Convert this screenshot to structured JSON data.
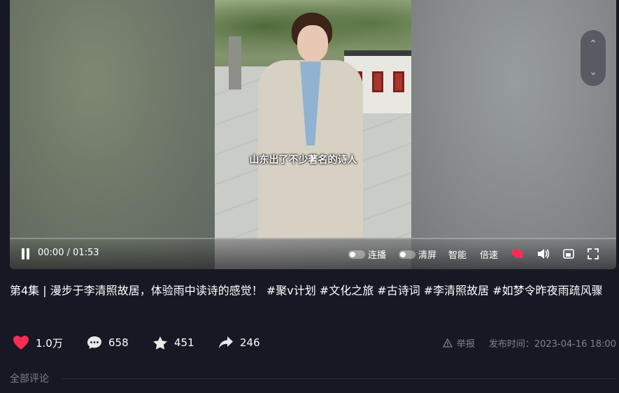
{
  "video": {
    "subtitle": "山东出了不少著名的诗人"
  },
  "player_controls": {
    "time_current": "00:00",
    "time_separator": "/",
    "time_total": "01:53",
    "autoplay_label": "连播",
    "clear_screen_label": "清屏",
    "smart_label": "智能",
    "speed_label": "倍速",
    "progress": 0
  },
  "post": {
    "title": "第4集 | 漫步于李清照故居，体验雨中读诗的感觉！ #聚v计划 #文化之旅 #古诗词 #李清照故居 #如梦令昨夜雨疏风骤",
    "likes": "1.0万",
    "comments": "658",
    "favorites": "451",
    "shares": "246",
    "report_label": "举报",
    "publish_time": "发布时间：2023-04-16 18:00"
  },
  "comments_section": {
    "label": "全部评论"
  },
  "colors": {
    "background": "#161823",
    "like_red": "#fe2c55",
    "danmaku_red": "#fe2c55"
  }
}
